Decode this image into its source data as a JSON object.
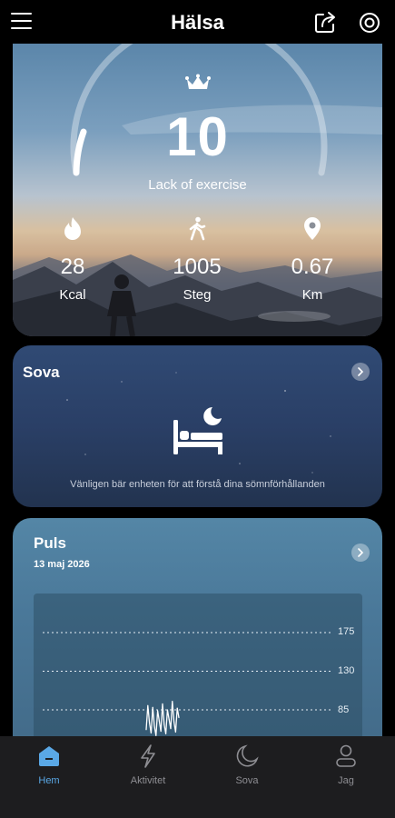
{
  "header": {
    "title": "Hälsa",
    "menu_icon": "hamburger-icon",
    "share_icon": "share-icon",
    "target_icon": "target-icon"
  },
  "score": {
    "value": "10",
    "label": "Lack of exercise",
    "progress": 0.1
  },
  "stats": [
    {
      "icon": "flame-icon",
      "value": "28",
      "unit": "Kcal"
    },
    {
      "icon": "walking-icon",
      "value": "1005",
      "unit": "Steg"
    },
    {
      "icon": "location-pin-icon",
      "value": "0.67",
      "unit": "Km"
    }
  ],
  "sleep": {
    "title": "Sova",
    "message": "Vänligen bär enheten för att förstå dina sömnförhållanden"
  },
  "pulse": {
    "title": "Puls",
    "date": "13 maj 2026",
    "ticks": [
      "175",
      "130",
      "85"
    ]
  },
  "chart_data": {
    "type": "line",
    "title": "",
    "xlabel": "",
    "ylabel": "",
    "y_ticks": [
      175,
      130,
      85
    ],
    "grid": true,
    "series": [
      {
        "values": [
          62,
          90,
          70,
          58,
          88,
          66,
          55,
          84,
          72,
          60,
          92,
          68,
          57,
          85,
          74,
          63,
          95,
          71,
          59,
          87,
          76
        ]
      }
    ]
  },
  "tabs": [
    {
      "label": "Hem",
      "icon": "home-icon",
      "active": true
    },
    {
      "label": "Aktivitet",
      "icon": "lightning-icon",
      "active": false
    },
    {
      "label": "Sova",
      "icon": "moon-icon",
      "active": false
    },
    {
      "label": "Jag",
      "icon": "person-icon",
      "active": false
    }
  ],
  "colors": {
    "accent": "#5aa8e6",
    "background": "#000000",
    "tabbar": "#1d1d1f"
  }
}
